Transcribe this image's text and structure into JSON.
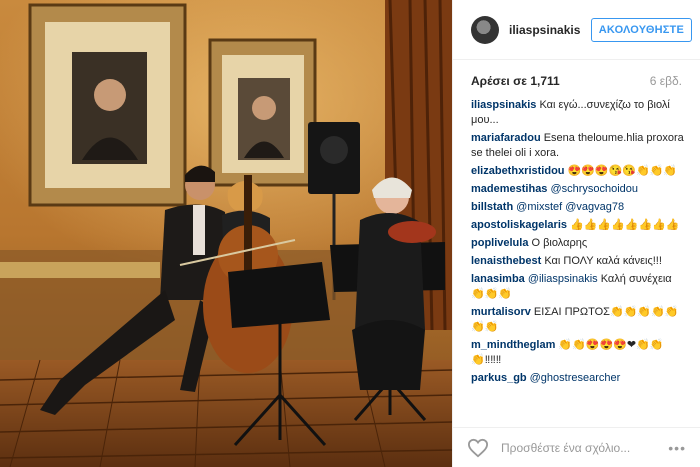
{
  "post": {
    "username": "iliaspsinakis",
    "follow_label": "ΑΚΟΛΟΥΘΗΣΤΕ",
    "likes": "Αρέσει σε 1,711",
    "age": "6 εβδ."
  },
  "comments": [
    {
      "author": "iliaspsinakis",
      "text": "Και εγώ...συνεχίζω το βιολί μου..."
    },
    {
      "author": "mariafaradou",
      "text": "Esena theloume.hlia proxora se thelei oli i xora."
    },
    {
      "author": "elizabethxristidou",
      "text": "😍😍😍😘😘👏👏👏"
    },
    {
      "author": "mademestihas",
      "mention": "@schrysochoidou",
      "text": ""
    },
    {
      "author": "billstath",
      "mention": "@mixstef @vagvag78",
      "text": ""
    },
    {
      "author": "apostoliskagelaris",
      "text": "👍👍👍👍👍👍👍👍"
    },
    {
      "author": "poplivelula",
      "text": "Ο βιολαρης"
    },
    {
      "author": "lenaisthebest",
      "text": "Και ΠΟΛΥ καλά κάνεις!!!"
    },
    {
      "author": "lanasimba",
      "mention": "@iliaspsinakis",
      "text": "Καλή συνέχεια 👏👏👏"
    },
    {
      "author": "murtalisorv",
      "text": "ΕΙΣΑΙ ΠΡΩΤΟΣ👏👏👏👏👏👏👏"
    },
    {
      "author": "m_mindtheglam",
      "text": "👏👏😍😍😍❤👏👏👏‼‼‼"
    },
    {
      "author": "parkus_gb",
      "mention": "@ghostresearcher",
      "text": ""
    }
  ],
  "footer": {
    "add_comment_placeholder": "Προσθέστε ένα σχόλιο...",
    "more_icon": "•••"
  },
  "colors": {
    "accent": "#3897f0",
    "link": "#003569",
    "muted": "#999999"
  }
}
